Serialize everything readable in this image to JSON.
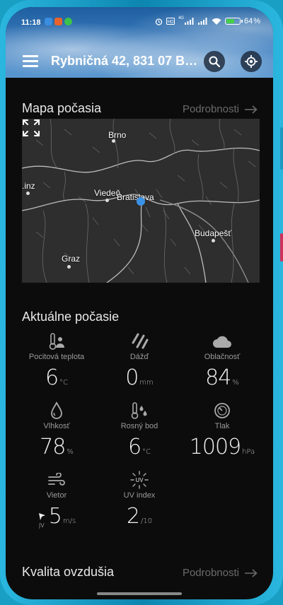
{
  "status_bar": {
    "time": "11:18",
    "battery_percent": "64",
    "network": "4G",
    "battery_level": 0.64
  },
  "header": {
    "location": "Rybničná 42, 831 07 Bra...",
    "menu_icon": "hamburger-menu-icon",
    "search_icon": "search-icon",
    "locate_icon": "gps-locate-icon"
  },
  "map_section": {
    "title": "Mapa počasia",
    "details_label": "Podrobnosti",
    "cities": {
      "brno": "Brno",
      "linz": ".inz",
      "vieden": "Viedeň",
      "bratislava": "Bratislava",
      "budapest": "Budapešť",
      "graz": "Graz"
    },
    "expand_icon": "fullscreen-expand-icon"
  },
  "current_weather": {
    "title": "Aktuálne počasie",
    "feels_like": {
      "label": "Pocitová teplota",
      "value": "6",
      "unit": "°C",
      "icon": "thermometer-person-icon"
    },
    "rain": {
      "label": "Dážď",
      "value": "0",
      "unit": "mm",
      "icon": "rain-icon"
    },
    "cloudiness": {
      "label": "Oblačnosť",
      "value": "84",
      "unit": "%",
      "icon": "cloud-icon"
    },
    "humidity": {
      "label": "Vlhkosť",
      "value": "78",
      "unit": "%",
      "icon": "droplet-icon"
    },
    "dew_point": {
      "label": "Rosný bod",
      "value": "6",
      "unit": "°C",
      "icon": "thermometer-drops-icon"
    },
    "pressure": {
      "label": "Tlak",
      "value": "1009",
      "unit": "hPa",
      "icon": "gauge-icon"
    },
    "wind": {
      "label": "Vietor",
      "value": "5",
      "unit": "m/s",
      "direction": "JV",
      "icon": "wind-icon"
    },
    "uv": {
      "label": "UV index",
      "value": "2",
      "unit": "/10",
      "icon": "uv-sun-icon",
      "icon_text": "UV"
    }
  },
  "air_quality": {
    "title": "Kvalita ovzdušia",
    "details_label": "Podrobnosti"
  },
  "colors": {
    "background": "#0c0c0c",
    "accent_location": "#3a92e6",
    "muted_text": "#6b6b6b",
    "label_text": "#9a9a9a"
  }
}
